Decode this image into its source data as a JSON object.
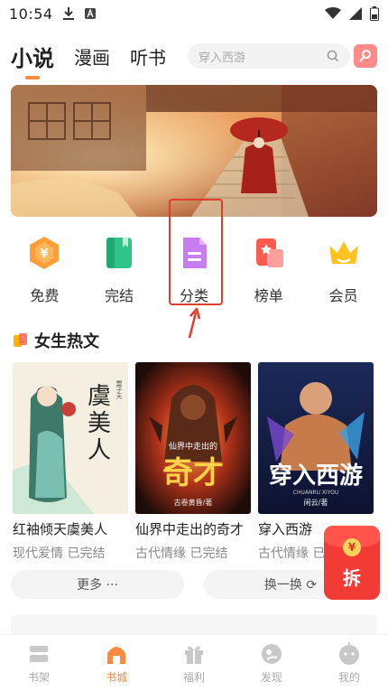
{
  "status_bar": {
    "time": "10:54"
  },
  "top_nav": {
    "tabs": [
      {
        "label": "小说",
        "active": true
      },
      {
        "label": "漫画",
        "active": false
      },
      {
        "label": "听书",
        "active": false
      }
    ],
    "search": {
      "placeholder": "穿入西游"
    }
  },
  "categories": [
    {
      "label": "免费",
      "icon": "coin-hexagon-icon"
    },
    {
      "label": "完结",
      "icon": "book-icon"
    },
    {
      "label": "分类",
      "icon": "document-icon"
    },
    {
      "label": "榜单",
      "icon": "ranking-icon"
    },
    {
      "label": "会员",
      "icon": "crown-icon"
    }
  ],
  "section": {
    "title": "女生热文"
  },
  "books": [
    {
      "title": "红袖倾天虞美人",
      "genre": "现代爱情",
      "status": "已完结",
      "cover_text": "虞美人",
      "cover_sub": "红袖倾天",
      "author": "鬻子天"
    },
    {
      "title": "仙界中走出的奇才",
      "genre": "古代情缘",
      "status": "已完结",
      "cover_text": "奇才",
      "cover_sub": "仙界中走出的",
      "author": "古卷黄昏/著"
    },
    {
      "title": "穿入西游",
      "genre": "古代情缘",
      "status": "已完结",
      "cover_text": "穿入西游",
      "cover_sub": "CHUANRU XIYOU",
      "author": "闲云/著"
    }
  ],
  "buttons": {
    "more": "更多 ···",
    "swap": "换一换 ⟳"
  },
  "red_packet": {
    "label": "拆",
    "coin": "¥"
  },
  "bottom_nav": [
    {
      "label": "书架",
      "active": false
    },
    {
      "label": "书城",
      "active": true
    },
    {
      "label": "福利",
      "active": false
    },
    {
      "label": "发现",
      "active": false
    },
    {
      "label": "我的",
      "active": false
    }
  ],
  "colors": {
    "accent": "#ff8a3d",
    "annotation": "#e23c2c",
    "red_packet": "#f23b35"
  }
}
